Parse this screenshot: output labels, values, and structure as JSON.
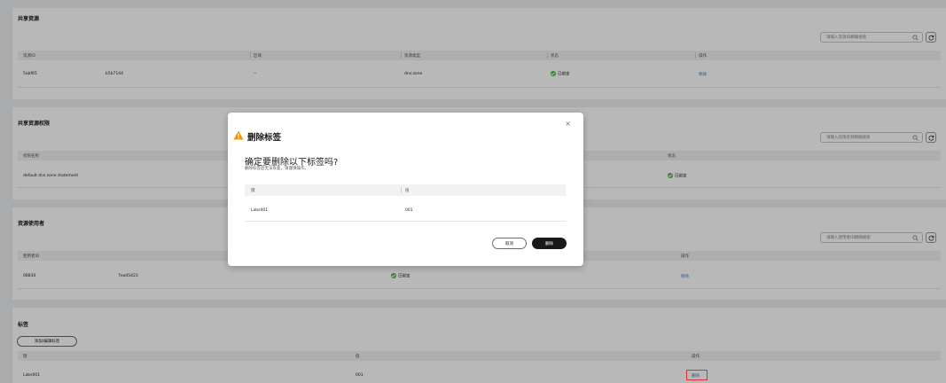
{
  "shared_resources": {
    "title": "共享资源",
    "search_placeholder": "请输入资源ID精确搜索",
    "columns": [
      "资源ID",
      "区域",
      "资源类型",
      "状态",
      "操作"
    ],
    "row": {
      "resource_id_prefix": "5abf65",
      "resource_id_suffix": "b5b7144",
      "region": "--",
      "type": "dns:zone",
      "status": "已绑定",
      "action": "移除"
    }
  },
  "permissions": {
    "title": "共享资源权限",
    "search_placeholder": "请输入权限名称精确搜索",
    "columns": [
      "权限名称",
      "状态"
    ],
    "row": {
      "name": "default dns zone statement",
      "status": "已绑定"
    }
  },
  "users": {
    "title": "资源使用者",
    "search_placeholder": "请输入使用者ID精确搜索",
    "columns": [
      "使用者ID",
      "操作"
    ],
    "row": {
      "user_id_prefix": "08830",
      "user_id_suffix": "7ead5423",
      "status": "已绑定",
      "action": "移除"
    }
  },
  "tags": {
    "title": "标签",
    "add_button": "添加/编辑标签",
    "columns": [
      "键",
      "值",
      "操作"
    ],
    "row": {
      "key": "Labs001",
      "value": "001",
      "action": "删除"
    }
  },
  "dialog": {
    "title": "删除标签",
    "question": "确定要删除以下标签吗?",
    "subtitle": "删除标签后无法恢复，请谨慎操作。",
    "columns": [
      "键",
      "值"
    ],
    "row": {
      "key": "Labs001",
      "value": "001"
    },
    "cancel": "取消",
    "confirm": "删除",
    "close": "×"
  },
  "colors": {
    "accent": "#3a73d8",
    "success": "#50b446",
    "warning": "#f09a00",
    "primary_button": "#191919",
    "highlight": "#e0302a"
  }
}
